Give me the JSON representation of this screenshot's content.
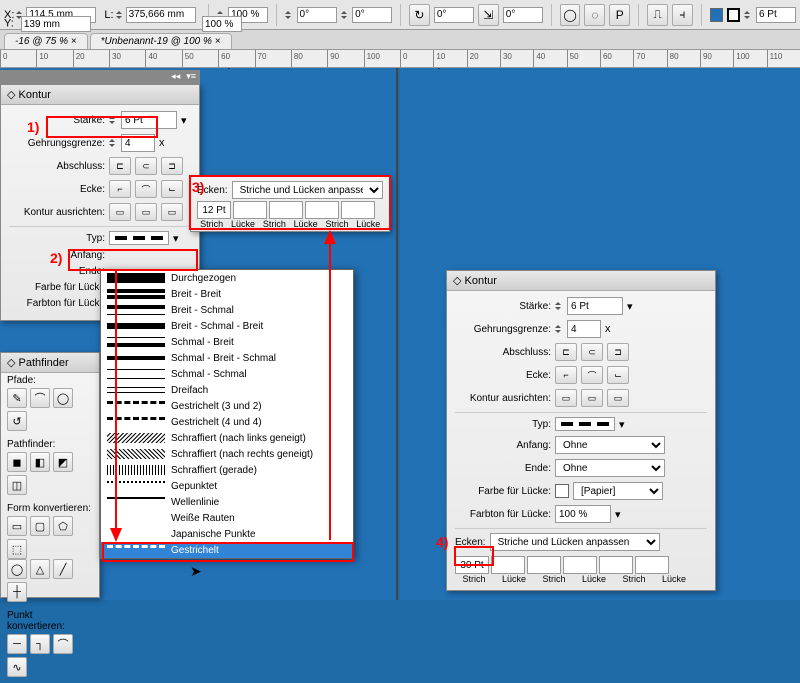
{
  "controlbar": {
    "x_label": "X:",
    "x_value": "114,5 mm",
    "y_label": "Y:",
    "y_value": "139 mm",
    "l_label": "L:",
    "l_value": "375,666 mm",
    "scale_x": "100 %",
    "scale_y": "100 %",
    "rotate": "0°",
    "shear": "0°",
    "rotate2": "0°",
    "shear2": "0°",
    "stroke_weight": "6 Pt"
  },
  "tabs": {
    "t1": "-16 @ 75 % ×",
    "t2": "*Unbenannt-19 @ 100 % ×"
  },
  "ruler_left": [
    "0",
    "10",
    "20",
    "30",
    "40",
    "50",
    "60",
    "70",
    "80",
    "90",
    "100"
  ],
  "ruler_right": [
    "0",
    "10",
    "20",
    "30",
    "40",
    "50",
    "60",
    "70",
    "80",
    "90",
    "100",
    "110"
  ],
  "konturL": {
    "title": "Kontur",
    "staerke_label": "Stärke:",
    "staerke_value": "6 Pt",
    "gehrung_label": "Gehrungsgrenze:",
    "gehrung_value": "4",
    "gehrung_x": "x",
    "abschluss_label": "Abschluss:",
    "ecke_label": "Ecke:",
    "ausrichten_label": "Kontur ausrichten:",
    "typ_label": "Typ:",
    "anfang_label": "Anfang:",
    "ende_label": "Ende:",
    "farbe_label": "Farbe für Lücke",
    "farbton_label": "Farbton für Lücke",
    "ecken_label": "Ecken:",
    "ecken_value": "Striche und Lücken anpassen",
    "dash_val": "12 Pt",
    "dash_labels": [
      "Strich",
      "Lücke",
      "Strich",
      "Lücke",
      "Strich",
      "Lücke"
    ]
  },
  "konturR": {
    "title": "Kontur",
    "staerke_label": "Stärke:",
    "staerke_value": "6 Pt",
    "gehrung_label": "Gehrungsgrenze:",
    "gehrung_value": "4",
    "gehrung_x": "x",
    "abschluss_label": "Abschluss:",
    "ecke_label": "Ecke:",
    "ausrichten_label": "Kontur ausrichten:",
    "typ_label": "Typ:",
    "anfang_label": "Anfang:",
    "anfang_value": "Ohne",
    "ende_label": "Ende:",
    "ende_value": "Ohne",
    "farbe_label": "Farbe für Lücke:",
    "farbe_value": "[Papier]",
    "farbton_label": "Farbton für Lücke:",
    "farbton_value": "100 %",
    "ecken_label": "Ecken:",
    "ecken_value": "Striche und Lücken anpassen",
    "dash_val": "30 Pt",
    "dash_labels": [
      "Strich",
      "Lücke",
      "Strich",
      "Lücke",
      "Strich",
      "Lücke"
    ]
  },
  "pathfinder": {
    "title": "Pathfinder",
    "pfade": "Pfade:",
    "pf": "Pathfinder:",
    "form": "Form konvertieren:",
    "punkt": "Punkt konvertieren:"
  },
  "dropdown": [
    {
      "name": "Durchgezogen",
      "style": "background:#000"
    },
    {
      "name": "Breit - Breit",
      "style": "border-top:4px solid #000;border-bottom:4px solid #000"
    },
    {
      "name": "Breit - Schmal",
      "style": "border-top:4px solid #000;border-bottom:1px solid #000"
    },
    {
      "name": "Breit - Schmal - Breit",
      "style": "border-top:3px solid #000;border-bottom:3px solid #000;height:6px;position:relative"
    },
    {
      "name": "Schmal - Breit",
      "style": "border-top:1px solid #000;border-bottom:4px solid #000"
    },
    {
      "name": "Schmal - Breit - Schmal",
      "style": "border-top:1px solid #000;border-bottom:1px solid #000;background:#000;height:4px;margin:3px 0"
    },
    {
      "name": "Schmal - Schmal",
      "style": "border-top:1px solid #000;border-bottom:1px solid #000"
    },
    {
      "name": "Dreifach",
      "style": "border-top:1px solid #000;border-bottom:1px solid #000;height:6px;position:relative"
    },
    {
      "name": "Gestrichelt (3 und 2)",
      "style": "border-top:3px dashed #000"
    },
    {
      "name": "Gestrichelt (4 und 4)",
      "style": "border-top:3px dashed #000"
    },
    {
      "name": "Schraffiert (nach links geneigt)",
      "style": "background:repeating-linear-gradient(-45deg,#000 0 1px,#fff 1px 3px)"
    },
    {
      "name": "Schraffiert (nach rechts geneigt)",
      "style": "background:repeating-linear-gradient(45deg,#000 0 1px,#fff 1px 3px)"
    },
    {
      "name": "Schraffiert (gerade)",
      "style": "background:repeating-linear-gradient(90deg,#000 0 1px,#fff 1px 3px)"
    },
    {
      "name": "Gepunktet",
      "style": "border-top:2px dotted #000"
    },
    {
      "name": "Wellenlinie",
      "style": "border-top:2px solid #000;"
    },
    {
      "name": "Weiße Rauten",
      "style": "color:#000"
    },
    {
      "name": "Japanische Punkte",
      "style": "color:#000"
    },
    {
      "name": "Gestrichelt",
      "style": "border-top:3px dashed #fff",
      "selected": true
    }
  ],
  "annotations": {
    "n1": "1)",
    "n2": "2)",
    "n3": "3)",
    "n4": "4)"
  }
}
